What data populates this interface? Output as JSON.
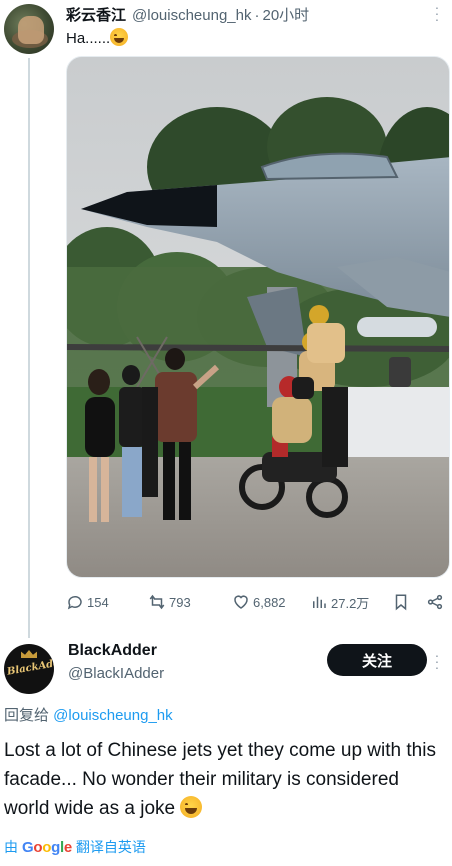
{
  "post": {
    "display_name": "彩云香江",
    "handle": "@louischeung_hk",
    "separator": "·",
    "time": "20小时",
    "text": "Ha......",
    "stats": {
      "replies": "154",
      "reposts": "793",
      "likes": "6,882",
      "views": "27.2万"
    }
  },
  "reply": {
    "display_name": "BlackAdder",
    "handle": "@BlackIAdder",
    "follow_label": "关注",
    "avatar_text": "BlackAdder",
    "replying_prefix": "回复给 ",
    "replying_to": "@louischeung_hk",
    "text": "Lost a lot of Chinese jets yet they come up with this facade... No wonder their military is considered world wide as a joke",
    "translate_by": "由",
    "translate_brand": "Google",
    "translate_label": "翻译自英语"
  },
  "icons": {
    "emoji": "face-with-tears-of-joy-icon",
    "reply": "comment-icon",
    "repost": "repost-icon",
    "like": "heart-icon",
    "views": "views-bar-icon",
    "bookmark": "bookmark-icon",
    "share": "share-icon",
    "more": "more-vertical-icon"
  },
  "colors": {
    "link": "#1d9bf0",
    "secondary_text": "#536471",
    "follow_button": "#0f1419"
  }
}
